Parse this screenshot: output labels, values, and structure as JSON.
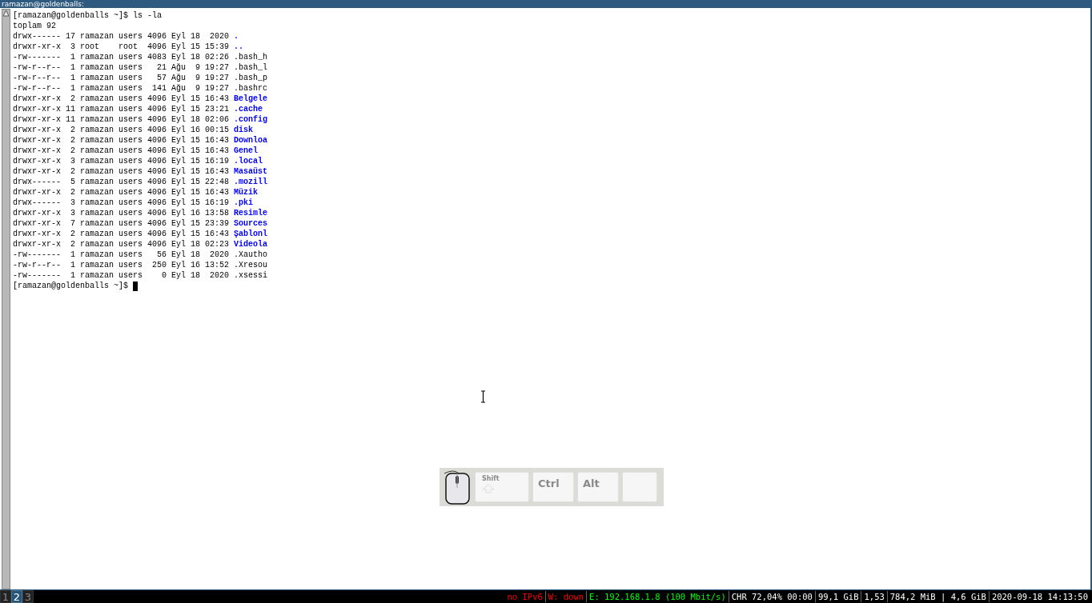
{
  "window": {
    "title": "ramazan@goldenballs:"
  },
  "terminal": {
    "command_line": "[ramazan@goldenballs ~]$ ls -la",
    "total": "toplam 92",
    "rows": [
      {
        "permissions": "drwx------",
        "links": "17",
        "owner": "ramazan",
        "group": "users",
        "size": "4096",
        "month": "Eyl",
        "day": "18",
        "time": "2020",
        "name": ".",
        "kind": "dir"
      },
      {
        "permissions": "drwxr-xr-x",
        "links": "3",
        "owner": "root",
        "group": "root",
        "size": "4096",
        "month": "Eyl",
        "day": "15",
        "time": "15:39",
        "name": "..",
        "kind": "dir"
      },
      {
        "permissions": "-rw-------",
        "links": "1",
        "owner": "ramazan",
        "group": "users",
        "size": "4083",
        "month": "Eyl",
        "day": "18",
        "time": "02:26",
        "name": ".bash_h",
        "kind": "file"
      },
      {
        "permissions": "-rw-r--r--",
        "links": "1",
        "owner": "ramazan",
        "group": "users",
        "size": "21",
        "month": "Ağu",
        "day": "9",
        "time": "19:27",
        "name": ".bash_l",
        "kind": "file"
      },
      {
        "permissions": "-rw-r--r--",
        "links": "1",
        "owner": "ramazan",
        "group": "users",
        "size": "57",
        "month": "Ağu",
        "day": "9",
        "time": "19:27",
        "name": ".bash_p",
        "kind": "file"
      },
      {
        "permissions": "-rw-r--r--",
        "links": "1",
        "owner": "ramazan",
        "group": "users",
        "size": "141",
        "month": "Ağu",
        "day": "9",
        "time": "19:27",
        "name": ".bashrc",
        "kind": "file"
      },
      {
        "permissions": "drwxr-xr-x",
        "links": "2",
        "owner": "ramazan",
        "group": "users",
        "size": "4096",
        "month": "Eyl",
        "day": "15",
        "time": "16:43",
        "name": "Belgele",
        "kind": "dir"
      },
      {
        "permissions": "drwxr-xr-x",
        "links": "11",
        "owner": "ramazan",
        "group": "users",
        "size": "4096",
        "month": "Eyl",
        "day": "15",
        "time": "23:21",
        "name": ".cache",
        "kind": "dir"
      },
      {
        "permissions": "drwxr-xr-x",
        "links": "11",
        "owner": "ramazan",
        "group": "users",
        "size": "4096",
        "month": "Eyl",
        "day": "18",
        "time": "02:06",
        "name": ".config",
        "kind": "dir"
      },
      {
        "permissions": "drwxr-xr-x",
        "links": "2",
        "owner": "ramazan",
        "group": "users",
        "size": "4096",
        "month": "Eyl",
        "day": "16",
        "time": "00:15",
        "name": "disk",
        "kind": "dir"
      },
      {
        "permissions": "drwxr-xr-x",
        "links": "2",
        "owner": "ramazan",
        "group": "users",
        "size": "4096",
        "month": "Eyl",
        "day": "15",
        "time": "16:43",
        "name": "Downloa",
        "kind": "dir"
      },
      {
        "permissions": "drwxr-xr-x",
        "links": "2",
        "owner": "ramazan",
        "group": "users",
        "size": "4096",
        "month": "Eyl",
        "day": "15",
        "time": "16:43",
        "name": "Genel",
        "kind": "dir"
      },
      {
        "permissions": "drwxr-xr-x",
        "links": "3",
        "owner": "ramazan",
        "group": "users",
        "size": "4096",
        "month": "Eyl",
        "day": "15",
        "time": "16:19",
        "name": ".local",
        "kind": "dir"
      },
      {
        "permissions": "drwxr-xr-x",
        "links": "2",
        "owner": "ramazan",
        "group": "users",
        "size": "4096",
        "month": "Eyl",
        "day": "15",
        "time": "16:43",
        "name": "Masaüst",
        "kind": "dir"
      },
      {
        "permissions": "drwx------",
        "links": "5",
        "owner": "ramazan",
        "group": "users",
        "size": "4096",
        "month": "Eyl",
        "day": "15",
        "time": "22:48",
        "name": ".mozill",
        "kind": "dir"
      },
      {
        "permissions": "drwxr-xr-x",
        "links": "2",
        "owner": "ramazan",
        "group": "users",
        "size": "4096",
        "month": "Eyl",
        "day": "15",
        "time": "16:43",
        "name": "Müzik",
        "kind": "dir"
      },
      {
        "permissions": "drwx------",
        "links": "3",
        "owner": "ramazan",
        "group": "users",
        "size": "4096",
        "month": "Eyl",
        "day": "15",
        "time": "16:19",
        "name": ".pki",
        "kind": "dir"
      },
      {
        "permissions": "drwxr-xr-x",
        "links": "3",
        "owner": "ramazan",
        "group": "users",
        "size": "4096",
        "month": "Eyl",
        "day": "16",
        "time": "13:58",
        "name": "Resimle",
        "kind": "dir"
      },
      {
        "permissions": "drwxr-xr-x",
        "links": "7",
        "owner": "ramazan",
        "group": "users",
        "size": "4096",
        "month": "Eyl",
        "day": "15",
        "time": "23:39",
        "name": "Sources",
        "kind": "dir"
      },
      {
        "permissions": "drwxr-xr-x",
        "links": "2",
        "owner": "ramazan",
        "group": "users",
        "size": "4096",
        "month": "Eyl",
        "day": "15",
        "time": "16:43",
        "name": "Şablonl",
        "kind": "dir"
      },
      {
        "permissions": "drwxr-xr-x",
        "links": "2",
        "owner": "ramazan",
        "group": "users",
        "size": "4096",
        "month": "Eyl",
        "day": "18",
        "time": "02:23",
        "name": "Videola",
        "kind": "dir"
      },
      {
        "permissions": "-rw-------",
        "links": "1",
        "owner": "ramazan",
        "group": "users",
        "size": "56",
        "month": "Eyl",
        "day": "18",
        "time": "2020",
        "name": ".Xautho",
        "kind": "file"
      },
      {
        "permissions": "-rw-r--r--",
        "links": "1",
        "owner": "ramazan",
        "group": "users",
        "size": "250",
        "month": "Eyl",
        "day": "16",
        "time": "13:52",
        "name": ".Xresou",
        "kind": "file"
      },
      {
        "permissions": "-rw-------",
        "links": "1",
        "owner": "ramazan",
        "group": "users",
        "size": "0",
        "month": "Eyl",
        "day": "18",
        "time": "2020",
        "name": ".xsessi",
        "kind": "file"
      }
    ],
    "prompt": "[ramazan@goldenballs ~]$"
  },
  "onscreen_keys": [
    {
      "kind": "mouse"
    },
    {
      "kind": "shift",
      "label": "Shift"
    },
    {
      "kind": "key",
      "label": "Ctrl"
    },
    {
      "kind": "key",
      "label": "Alt"
    },
    {
      "kind": "blank"
    }
  ],
  "workspaces": [
    {
      "label": "1",
      "selected": false
    },
    {
      "label": "2",
      "selected": true
    },
    {
      "label": "3",
      "selected": false
    }
  ],
  "status": [
    {
      "text": "no IPv6",
      "color": "#ff0000"
    },
    {
      "text": "W: down",
      "color": "#ff0000"
    },
    {
      "text": "E: 192.168.1.8 (100 Mbit/s)",
      "color": "#00ff00"
    },
    {
      "text": "CHR 72,04% 00:00",
      "color": "#ffffff"
    },
    {
      "text": "99,1 GiB",
      "color": "#ffffff"
    },
    {
      "text": "1,53",
      "color": "#ffffff"
    },
    {
      "text": "784,2 MiB | 4,6 GiB",
      "color": "#ffffff"
    },
    {
      "text": "2020-09-18 14:13:50",
      "color": "#ffffff"
    }
  ]
}
